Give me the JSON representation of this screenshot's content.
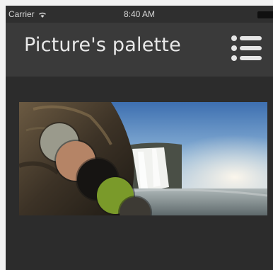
{
  "status_bar": {
    "carrier": "Carrier",
    "time": "8:40 AM"
  },
  "nav": {
    "title": "Picture's palette",
    "menu_icon": "hamburger-list-icon"
  },
  "palette": {
    "colors": [
      "#9a9a8c",
      "#b58466",
      "#161412",
      "#7a9a2a",
      "#3d3a34"
    ]
  },
  "picture": {
    "subject": "waterfall photo"
  }
}
